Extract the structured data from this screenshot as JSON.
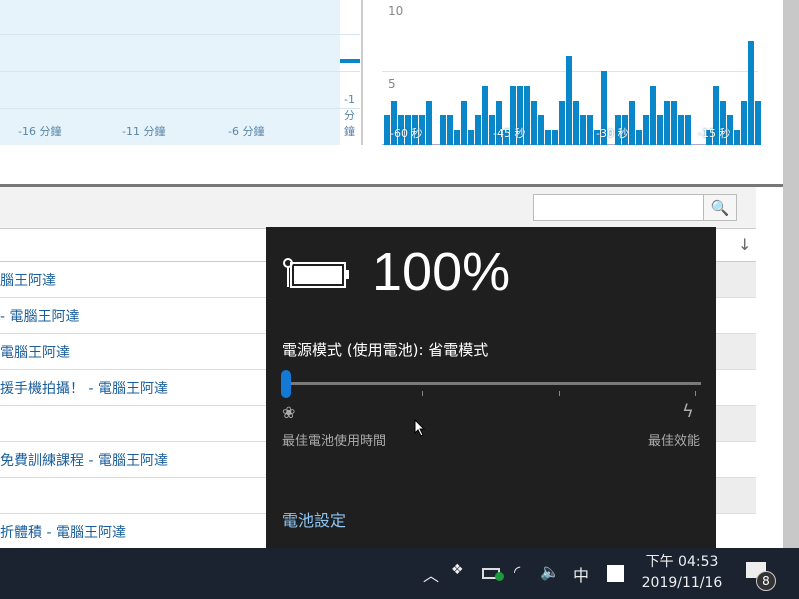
{
  "chart_data": [
    {
      "type": "bar",
      "title": "",
      "xlabel": "",
      "ylabel": "",
      "tick_labels": [
        "-16 分鐘",
        "-11 分鐘",
        "-6 分鐘",
        "-1 分鐘"
      ],
      "note": "minutes chart, only last bar visible"
    },
    {
      "type": "bar",
      "ylim": [
        0,
        10
      ],
      "yticks": [
        "10",
        "5"
      ],
      "x_tick_labels": [
        "-60 秒",
        "-45 秒",
        "-30 秒",
        "-15 秒"
      ],
      "values": [
        2,
        3,
        2,
        2,
        2,
        2,
        3,
        0,
        2,
        2,
        1,
        3,
        1,
        2,
        4,
        2,
        3,
        1,
        4,
        4,
        4,
        3,
        2,
        1,
        1,
        3,
        6,
        3,
        2,
        2,
        1,
        5,
        0,
        2,
        2,
        3,
        1,
        2,
        4,
        2,
        3,
        3,
        2,
        2,
        0,
        0,
        1,
        4,
        3,
        2,
        1,
        3,
        7,
        3
      ]
    }
  ],
  "table": {
    "rows": [
      "腦王阿達",
      "- 電腦王阿達",
      "電腦王阿達",
      "援手機拍攝！ - 電腦王阿達",
      "",
      "免費訓練課程 - 電腦王阿達",
      "",
      "折體積 - 電腦王阿達"
    ]
  },
  "battery": {
    "percent": "100%",
    "mode_label": "電源模式 (使用電池): 省電模式",
    "slider_value": 0,
    "left_caption": "最佳電池使用時間",
    "right_caption": "最佳效能",
    "settings_link": "電池設定"
  },
  "taskbar": {
    "ime": "中",
    "time": "下午 04:53",
    "date": "2019/11/16",
    "notifications": "8"
  }
}
